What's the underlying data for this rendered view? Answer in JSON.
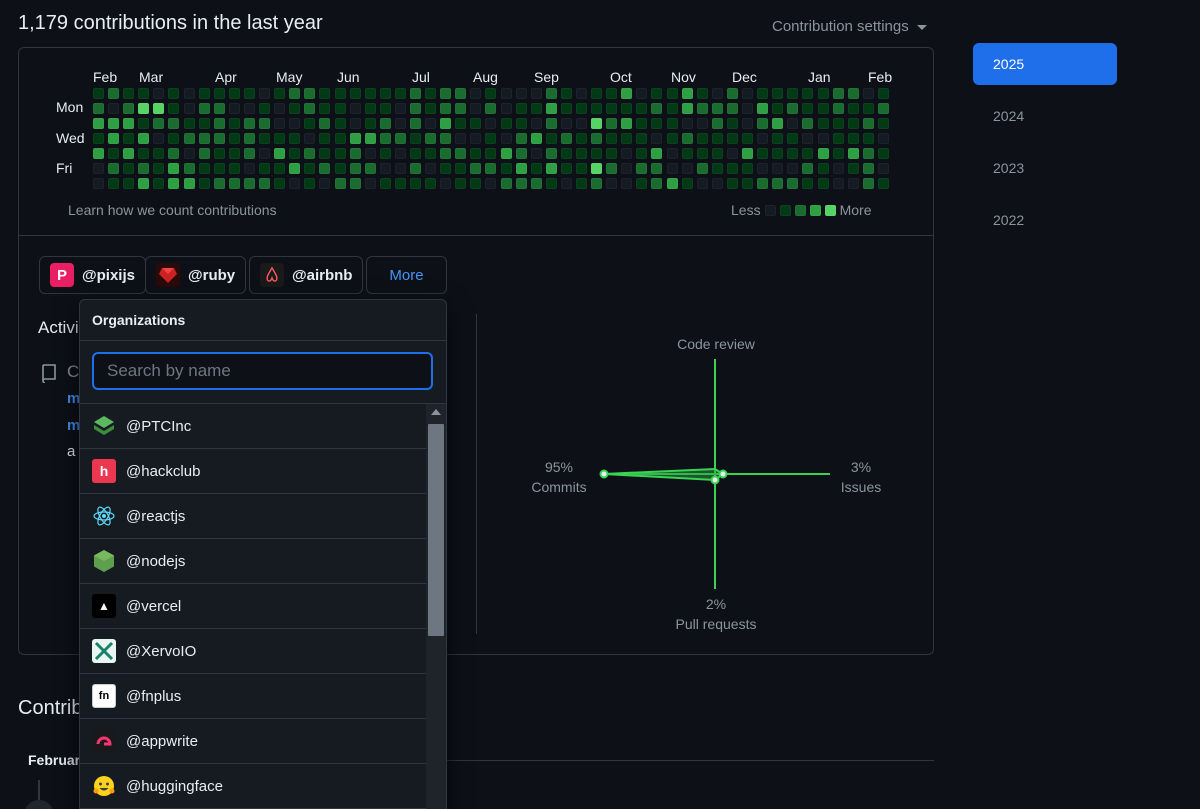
{
  "header": {
    "title": "1,179 contributions in the last year",
    "settings_label": "Contribution settings"
  },
  "calendar": {
    "months": [
      "Feb",
      "Mar",
      "Apr",
      "May",
      "Jun",
      "Jul",
      "Aug",
      "Sep",
      "Oct",
      "Nov",
      "Dec",
      "Jan",
      "Feb"
    ],
    "day_labels": [
      "Mon",
      "Wed",
      "Fri"
    ],
    "learn_text": "Learn how we count contributions",
    "legend_less": "Less",
    "legend_more": "More",
    "colors": {
      "l0": "#151b23",
      "l1": "#033a16",
      "l2": "#196c2e",
      "l3": "#2ea043",
      "l4": "#56d364"
    }
  },
  "organizations": [
    {
      "handle": "@pixijs",
      "logo": "pixijs-icon"
    },
    {
      "handle": "@ruby",
      "logo": "ruby-icon"
    },
    {
      "handle": "@airbnb",
      "logo": "airbnb-icon"
    }
  ],
  "more_label": "More",
  "behind": {
    "activity": "Activi",
    "c": "C",
    "m1": "m",
    "m2": "m",
    "a": "a"
  },
  "radar": {
    "top": {
      "percent": "",
      "label": "Code review"
    },
    "left": {
      "percent": "95%",
      "label": "Commits"
    },
    "right": {
      "percent": "3%",
      "label": "Issues"
    },
    "bottom": {
      "percent": "2%",
      "label": "Pull requests"
    }
  },
  "contrib_activity": {
    "heading": "Contrib",
    "month_label": "Februar"
  },
  "years": [
    "2025",
    "2024",
    "2023",
    "2022"
  ],
  "active_year": "2025",
  "dropdown": {
    "title": "Organizations",
    "placeholder": "Search by name",
    "items": [
      {
        "handle": "@PTCInc",
        "icon": "ptcinc-icon"
      },
      {
        "handle": "@hackclub",
        "icon": "hackclub-icon"
      },
      {
        "handle": "@reactjs",
        "icon": "react-icon"
      },
      {
        "handle": "@nodejs",
        "icon": "nodejs-icon"
      },
      {
        "handle": "@vercel",
        "icon": "vercel-icon"
      },
      {
        "handle": "@XervoIO",
        "icon": "xervo-icon"
      },
      {
        "handle": "@fnplus",
        "icon": "fnplus-icon"
      },
      {
        "handle": "@appwrite",
        "icon": "appwrite-icon"
      },
      {
        "handle": "@huggingface",
        "icon": "huggingface-icon"
      }
    ]
  }
}
